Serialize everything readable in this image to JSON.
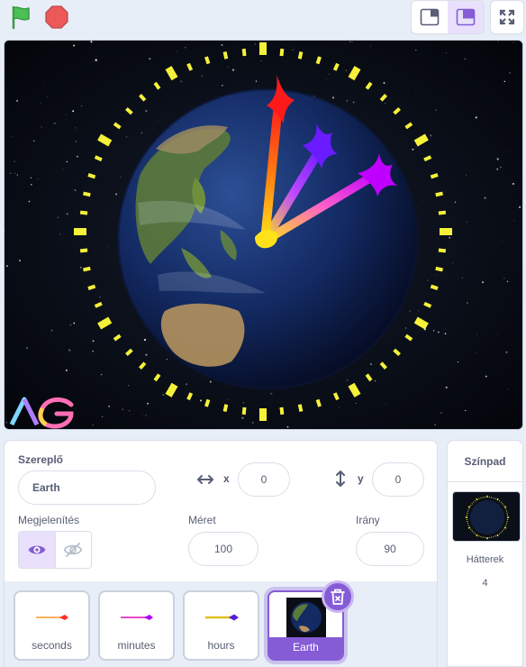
{
  "toolbar": {
    "flag_icon": "green-flag-icon",
    "stop_icon": "stop-icon",
    "small_stage_icon": "small-stage-icon",
    "normal_stage_icon": "normal-stage-icon",
    "fullscreen_icon": "fullscreen-icon"
  },
  "stage": {
    "logo_text": "AG"
  },
  "sprite_info": {
    "sprite_label": "Szereplő",
    "sprite_name": "Earth",
    "x_label": "x",
    "x_value": "0",
    "y_label": "y",
    "y_value": "0",
    "show_label": "Megjelenítés",
    "size_label": "Méret",
    "size_value": "100",
    "direction_label": "Irány",
    "direction_value": "90"
  },
  "sprites": [
    {
      "name": "seconds",
      "color": "#ff2d2d"
    },
    {
      "name": "minutes",
      "color": "#b000ff"
    },
    {
      "name": "hours",
      "color": "#5a1bd6"
    },
    {
      "name": "Earth",
      "selected": true
    }
  ],
  "stage_pane": {
    "title": "Színpad",
    "backdrops_label": "Hátterek",
    "backdrops_count": "4"
  },
  "colors": {
    "accent": "#855cd6",
    "tick": "#f5f13a",
    "flag": "#4cbf56",
    "stop": "#ec5959"
  }
}
